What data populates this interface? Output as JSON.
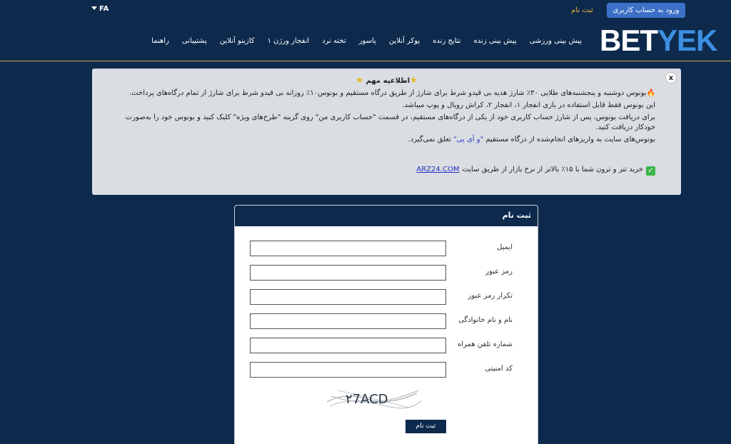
{
  "topbar": {
    "lang": "FA",
    "register_link": "ثبت نام",
    "login_button": "ورود به حساب کاربری"
  },
  "logo": {
    "bet": "BET",
    "yek": "YEK"
  },
  "nav": [
    "پیش بینی ورزشی",
    "پیش بینی زنده",
    "نتایج زنده",
    "پوکر آنلاین",
    "پاسور",
    "تخته نرد",
    "انفجار ورژن ۱",
    "کازینو آنلاین",
    "پشتیبانی",
    "راهنما"
  ],
  "notice": {
    "close": "x",
    "title": "اطلاعیه مهم",
    "line1": "بونوس دوشنبه و پنجشنبه‌های طلایی ۳۰٪ شارژ هدیه بی قیدو شرط برای شارژ از طریق درگاه مستقیم و بونوس۱۰٪ روزانه بی قیدو شرط برای شارژ از تمام درگاه‌های پرداخت.",
    "line2": "این بونوس فقط قابل استفاده در بازی انفجار ۱، انفجار ۲، کراش رویال و پوپ میباشد.",
    "line3": "برای دریافت بونوس، پس از شارژ حساب کاربری خود از یکی از درگاه‌های مستقیم، در قسمت \"حساب کاربری من\" روی گزینه \"طرح‌های ویژه\" کلیک کنید و بونوس خود را به‌صورت خودکار دریافت کنید.",
    "line4_a": "بونوس‌های سایت به واریزهای انجام‌شده از درگاه مستقیم ",
    "line4_hl": "\"و آی پی\"",
    "line4_b": " تعلق نمی‌گیرد.",
    "arz_text": "خرید تتر و ترون شما با ۱۵٪ بالاتر از نرخ بازار از طریق سایت",
    "arz_link": "ARZ24.COM"
  },
  "register": {
    "title": "ثبت نام",
    "fields": [
      {
        "label": "ایمیل",
        "value": ""
      },
      {
        "label": "رمز عبور",
        "value": ""
      },
      {
        "label": "تکرار رمز عبور",
        "value": ""
      },
      {
        "label": "نام و نام خانوادگی",
        "value": ""
      },
      {
        "label": "شماره تلفن همراه",
        "value": ""
      },
      {
        "label": "کد امنیتی",
        "value": ""
      }
    ],
    "captcha_text": "۲7ACD",
    "submit": "ثبت نام"
  },
  "colors": {
    "background": "#0d2a4d",
    "accent": "#3c71c7",
    "logo_blue": "#3d8fe0",
    "gold": "#f2b233"
  }
}
